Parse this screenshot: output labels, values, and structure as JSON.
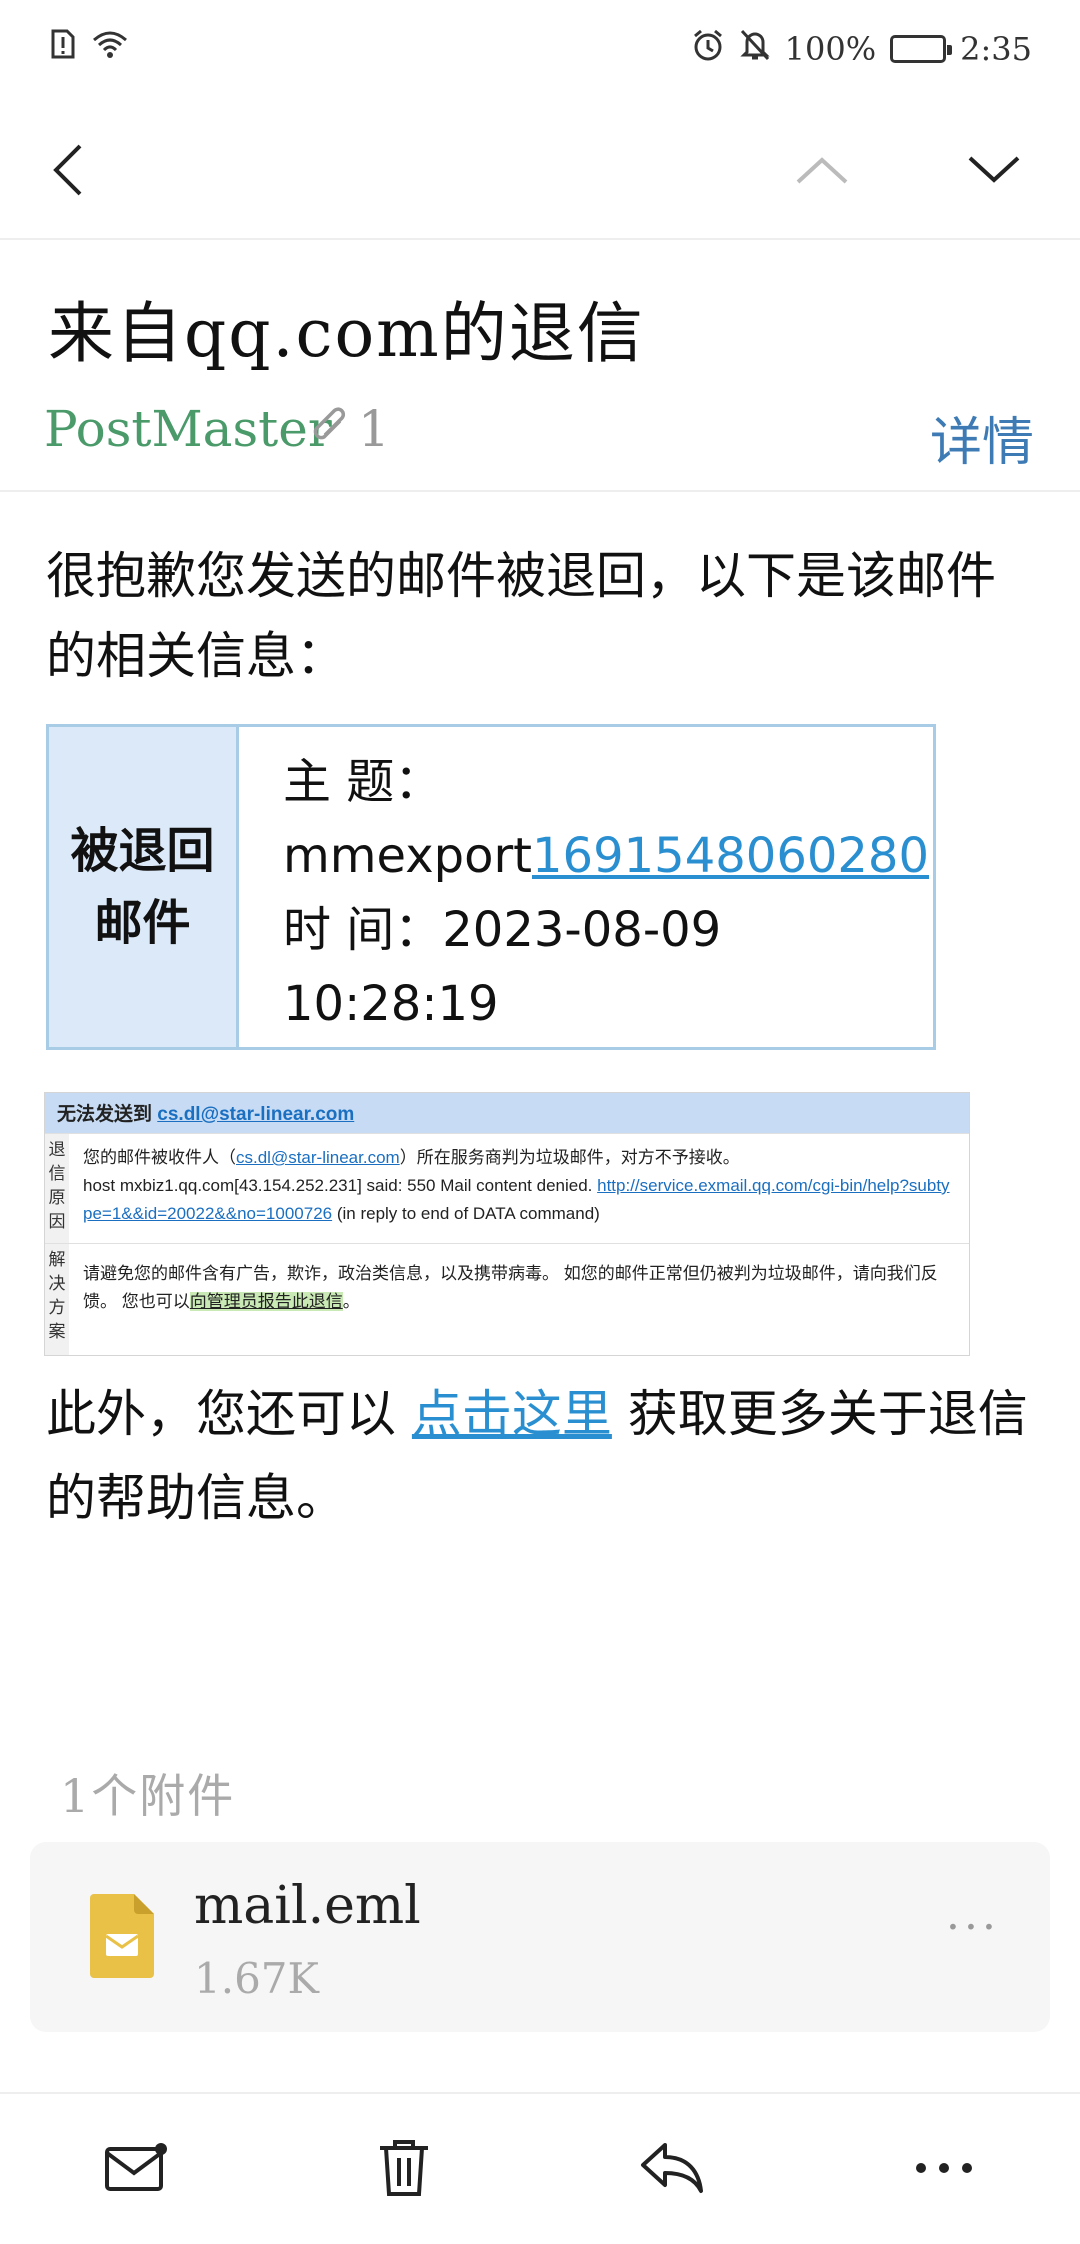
{
  "status_bar": {
    "battery": "100%",
    "time": "2:35"
  },
  "email": {
    "subject": "来自qq.com的退信",
    "sender": "PostMaster",
    "attachment_count": "1",
    "details_label": "详情",
    "intro_text": "很抱歉您发送的邮件被退回，以下是该邮件的相关信息：",
    "bounced": {
      "label_line1": "被退回",
      "label_line2": "邮件",
      "subject_label": "主 题：",
      "subject_prefix": "mmexport",
      "subject_number": "1691548060280",
      "time_label": "时 间：",
      "time_date": "2023-08-09",
      "time_clock": "10:28:19"
    },
    "notice": {
      "head_text": "无法发送到 ",
      "head_address": "cs.dl@star-linear.com",
      "reason_side": "退信原因",
      "reason_line1_a": "您的邮件被收件人（",
      "reason_line1_address": "cs.dl@star-linear.com",
      "reason_line1_b": "）所在服务商判为垃圾邮件，对方不予接收。",
      "reason_line2_a": "host mxbiz1.qq.com[43.154.252.231] said: 550 Mail content denied. ",
      "reason_line2_link": "http://service.exmail.qq.com/cgi-bin/help?subtype=1&&id=20022&&no=1000726",
      "reason_line2_b": " (in reply to end of DATA command)",
      "solution_side": "解决方案",
      "solution_a": "请避免您的邮件含有广告，欺诈，政治类信息，以及携带病毒。 如您的邮件正常但仍被判为垃圾邮件，请向我们反馈。 您也可以",
      "solution_link": "向管理员报告此退信",
      "solution_b": "。"
    },
    "more_a": "此外，您还可以 ",
    "more_link": "点击这里",
    "more_b": " 获取更多关于退信的帮助信息。"
  },
  "attachments": {
    "section_title": "1个附件",
    "items": [
      {
        "name": "mail.eml",
        "size": "1.67K",
        "more": "···"
      }
    ]
  },
  "colors": {
    "sender": "#4a9a6a",
    "link": "#2a8fd0",
    "details": "#3e7bb5",
    "file_icon": "#e8c146"
  }
}
